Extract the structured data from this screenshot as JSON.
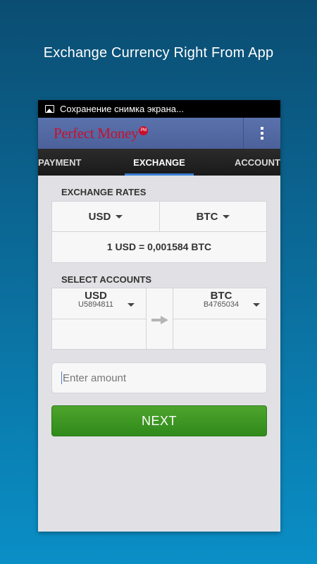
{
  "promo": {
    "headline": "Exchange Currency Right From App"
  },
  "status_bar": {
    "notification": "Сохранение снимка экрана..."
  },
  "app_bar": {
    "logo_text": "Perfect Money",
    "logo_badge": "PM"
  },
  "tabs": [
    {
      "label": "PAYMENT",
      "active": false
    },
    {
      "label": "EXCHANGE",
      "active": true
    },
    {
      "label": "ACCOUNT",
      "active": false
    }
  ],
  "exchange_rates": {
    "label": "EXCHANGE RATES",
    "from_currency": "USD",
    "to_currency": "BTC",
    "rate_text": "1 USD = 0,001584 BTC"
  },
  "select_accounts": {
    "label": "SELECT ACCOUNTS",
    "from": {
      "currency": "USD",
      "account_id": "U5894811"
    },
    "to": {
      "currency": "BTC",
      "account_id": "B4765034"
    }
  },
  "amount_input": {
    "placeholder": "Enter amount",
    "value": ""
  },
  "next_button": {
    "label": "NEXT"
  },
  "colors": {
    "accent": "#3a7fd1",
    "next_button": "#3d971f",
    "logo": "#c8102e",
    "app_bar": "#5069a3"
  }
}
